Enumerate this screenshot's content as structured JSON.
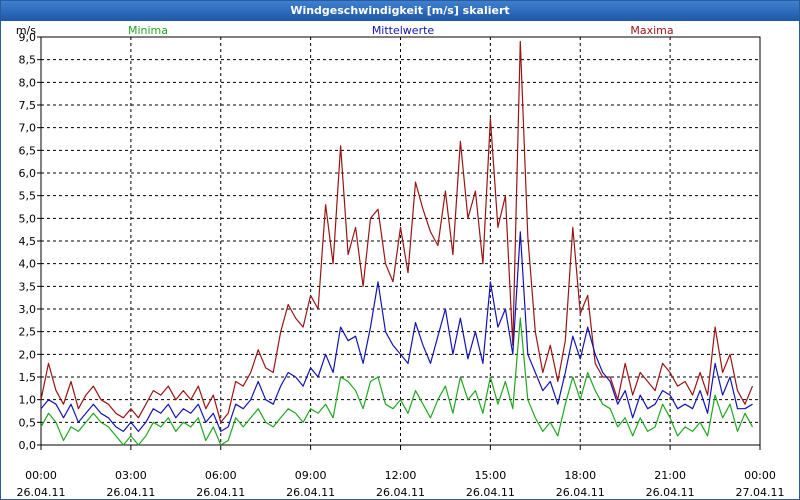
{
  "window": {
    "title": "Windgeschwindigkeit [m/s] skaliert"
  },
  "chart_data": {
    "type": "line",
    "title": "Windgeschwindigkeit [m/s] skaliert",
    "ylabel": "m/s",
    "ylim": [
      0,
      9.0
    ],
    "y_ticks": [
      "0,0",
      "0,5",
      "1,0",
      "1,5",
      "2,0",
      "2,5",
      "3,0",
      "3,5",
      "4,0",
      "4,5",
      "5,0",
      "5,5",
      "6,0",
      "6,5",
      "7,0",
      "7,5",
      "8,0",
      "8,5",
      "9,0"
    ],
    "x_range_hours": [
      0,
      24
    ],
    "x_ticks": [
      {
        "time": "00:00",
        "date": "26.04.11"
      },
      {
        "time": "03:00",
        "date": "26.04.11"
      },
      {
        "time": "06:00",
        "date": "26.04.11"
      },
      {
        "time": "09:00",
        "date": "26.04.11"
      },
      {
        "time": "12:00",
        "date": "26.04.11"
      },
      {
        "time": "15:00",
        "date": "26.04.11"
      },
      {
        "time": "18:00",
        "date": "26.04.11"
      },
      {
        "time": "21:00",
        "date": "26.04.11"
      },
      {
        "time": "00:00",
        "date": "27.04.11"
      }
    ],
    "grid": true,
    "legend_position": "top",
    "x": [
      0,
      0.25,
      0.5,
      0.75,
      1,
      1.25,
      1.5,
      1.75,
      2,
      2.25,
      2.5,
      2.75,
      3,
      3.25,
      3.5,
      3.75,
      4,
      4.25,
      4.5,
      4.75,
      5,
      5.25,
      5.5,
      5.75,
      6,
      6.25,
      6.5,
      6.75,
      7,
      7.25,
      7.5,
      7.75,
      8,
      8.25,
      8.5,
      8.75,
      9,
      9.25,
      9.5,
      9.75,
      10,
      10.25,
      10.5,
      10.75,
      11,
      11.25,
      11.5,
      11.75,
      12,
      12.25,
      12.5,
      12.75,
      13,
      13.25,
      13.5,
      13.75,
      14,
      14.25,
      14.5,
      14.75,
      15,
      15.25,
      15.5,
      15.75,
      16,
      16.25,
      16.5,
      16.75,
      17,
      17.25,
      17.5,
      17.75,
      18,
      18.25,
      18.5,
      18.75,
      19,
      19.25,
      19.5,
      19.75,
      20,
      20.25,
      20.5,
      20.75,
      21,
      21.25,
      21.5,
      21.75,
      22,
      22.25,
      22.5,
      22.75,
      23,
      23.25,
      23.5,
      23.75,
      24
    ],
    "series": [
      {
        "name": "Minima",
        "color": "#22a622",
        "values": [
          0.4,
          0.7,
          0.5,
          0.1,
          0.4,
          0.3,
          0.5,
          0.7,
          0.5,
          0.4,
          0.2,
          0.0,
          0.2,
          0.0,
          0.2,
          0.5,
          0.4,
          0.6,
          0.3,
          0.5,
          0.4,
          0.6,
          0.1,
          0.4,
          0.0,
          0.1,
          0.6,
          0.4,
          0.6,
          0.8,
          0.5,
          0.4,
          0.6,
          0.8,
          0.7,
          0.5,
          0.8,
          0.7,
          0.9,
          0.6,
          1.5,
          1.4,
          1.2,
          0.8,
          1.4,
          1.5,
          0.9,
          0.8,
          1.0,
          0.7,
          1.2,
          0.9,
          0.6,
          1.0,
          1.3,
          0.7,
          1.5,
          1.0,
          1.2,
          0.7,
          1.5,
          0.9,
          1.4,
          0.8,
          2.8,
          1.0,
          0.6,
          0.3,
          0.5,
          0.2,
          0.9,
          1.5,
          1.0,
          1.6,
          1.2,
          0.9,
          0.8,
          0.4,
          0.6,
          0.2,
          0.6,
          0.3,
          0.4,
          0.9,
          0.6,
          0.2,
          0.4,
          0.3,
          0.5,
          0.2,
          1.1,
          0.6,
          0.9,
          0.3,
          0.7,
          0.4
        ]
      },
      {
        "name": "Mittelwerte",
        "color": "#1414b4",
        "values": [
          0.8,
          1.0,
          0.9,
          0.6,
          0.9,
          0.5,
          0.7,
          0.9,
          0.7,
          0.6,
          0.4,
          0.3,
          0.5,
          0.3,
          0.5,
          0.8,
          0.7,
          0.9,
          0.6,
          0.8,
          0.7,
          0.9,
          0.5,
          0.7,
          0.3,
          0.4,
          0.9,
          0.8,
          1.0,
          1.4,
          1.0,
          0.9,
          1.3,
          1.6,
          1.5,
          1.3,
          1.7,
          1.5,
          2.0,
          1.6,
          2.6,
          2.3,
          2.4,
          1.8,
          2.6,
          3.6,
          2.5,
          2.2,
          2.0,
          1.8,
          2.7,
          2.2,
          1.8,
          2.4,
          3.0,
          2.0,
          2.8,
          1.9,
          2.5,
          1.8,
          3.6,
          2.6,
          3.0,
          2.0,
          4.7,
          2.0,
          1.6,
          1.2,
          1.4,
          0.9,
          1.6,
          2.4,
          1.9,
          2.6,
          2.0,
          1.6,
          1.4,
          0.9,
          1.2,
          0.6,
          1.1,
          0.8,
          0.9,
          1.2,
          1.1,
          0.8,
          0.9,
          0.8,
          1.2,
          0.7,
          1.8,
          1.1,
          1.5,
          0.8,
          0.8,
          0.9
        ]
      },
      {
        "name": "Maxima",
        "color": "#9a1414",
        "values": [
          1.0,
          1.8,
          1.2,
          0.9,
          1.4,
          0.8,
          1.1,
          1.3,
          1.0,
          0.9,
          0.7,
          0.6,
          0.8,
          0.6,
          0.9,
          1.2,
          1.1,
          1.3,
          1.0,
          1.2,
          1.0,
          1.3,
          0.8,
          1.1,
          0.5,
          0.7,
          1.4,
          1.3,
          1.6,
          2.1,
          1.7,
          1.6,
          2.5,
          3.1,
          2.8,
          2.6,
          3.3,
          3.0,
          5.3,
          4.0,
          6.6,
          4.2,
          4.8,
          3.5,
          5.0,
          5.2,
          4.0,
          3.6,
          4.8,
          3.8,
          5.8,
          5.2,
          4.7,
          4.4,
          5.6,
          4.2,
          6.7,
          5.0,
          5.6,
          4.0,
          7.2,
          4.8,
          5.5,
          2.2,
          8.9,
          4.6,
          2.5,
          1.6,
          2.2,
          1.4,
          2.3,
          4.8,
          2.9,
          3.3,
          1.8,
          1.5,
          1.5,
          1.0,
          1.8,
          1.1,
          1.6,
          1.4,
          1.2,
          1.8,
          1.6,
          1.3,
          1.4,
          1.1,
          1.6,
          1.1,
          2.6,
          1.6,
          2.0,
          1.2,
          0.9,
          1.3
        ]
      }
    ]
  }
}
